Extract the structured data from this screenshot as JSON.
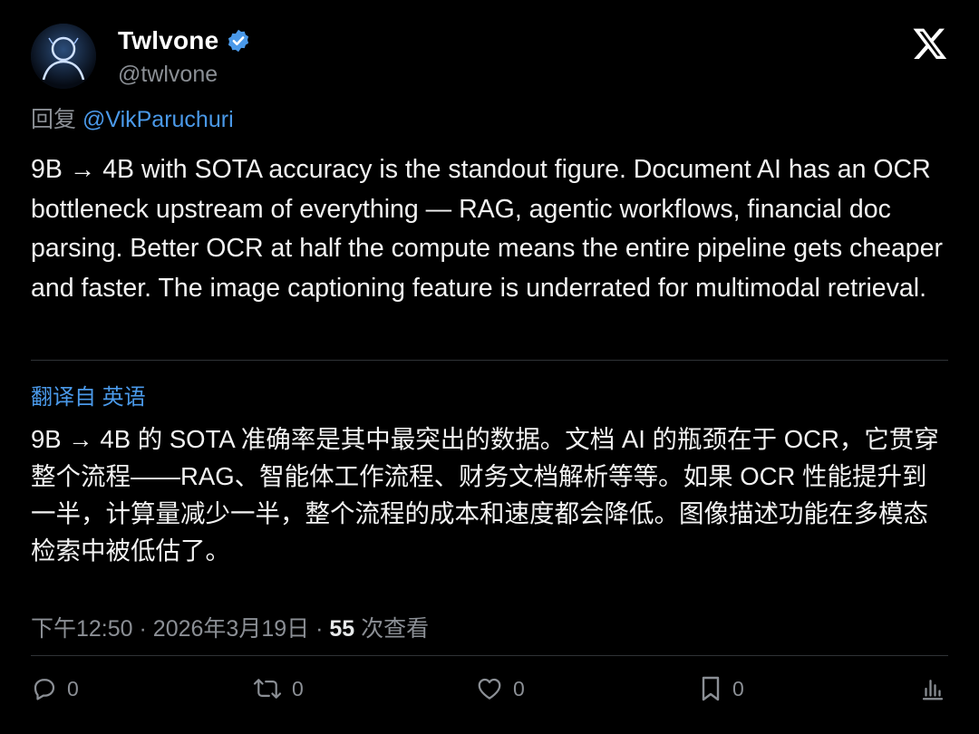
{
  "author": {
    "display_name": "Twlvone",
    "handle": "@twlvone",
    "verified": true
  },
  "reply": {
    "prefix": "回复",
    "mention": "@VikParuchuri"
  },
  "tweet": {
    "text": "9B → 4B with SOTA accuracy is the standout figure. Document AI has an OCR bottleneck upstream of everything — RAG, agentic workflows, financial doc parsing. Better OCR at half the compute means the entire pipeline gets cheaper and faster. The image captioning feature is underrated for multimodal retrieval."
  },
  "translation": {
    "label": "翻译自 英语",
    "text": "9B → 4B 的 SOTA 准确率是其中最突出的数据。文档 AI 的瓶颈在于 OCR，它贯穿整个流程——RAG、智能体工作流程、财务文档解析等等。如果 OCR 性能提升到一半，计算量减少一半，整个流程的成本和速度都会降低。图像描述功能在多模态检索中被低估了。"
  },
  "meta": {
    "time": "下午12:50",
    "date": "2026年3月19日",
    "views_count": "55",
    "views_label": "次查看",
    "separator": "·"
  },
  "actions": {
    "reply_count": "0",
    "retweet_count": "0",
    "like_count": "0",
    "bookmark_count": "0"
  },
  "icons": {
    "logo": "x-logo-icon",
    "verified": "verified-badge-icon",
    "reply": "reply-icon",
    "retweet": "retweet-icon",
    "like": "heart-icon",
    "bookmark": "bookmark-icon",
    "analytics": "analytics-icon"
  },
  "colors": {
    "background": "#000000",
    "accent": "#4a99e9",
    "muted": "#8b8f95",
    "text": "#f2f2f2"
  }
}
